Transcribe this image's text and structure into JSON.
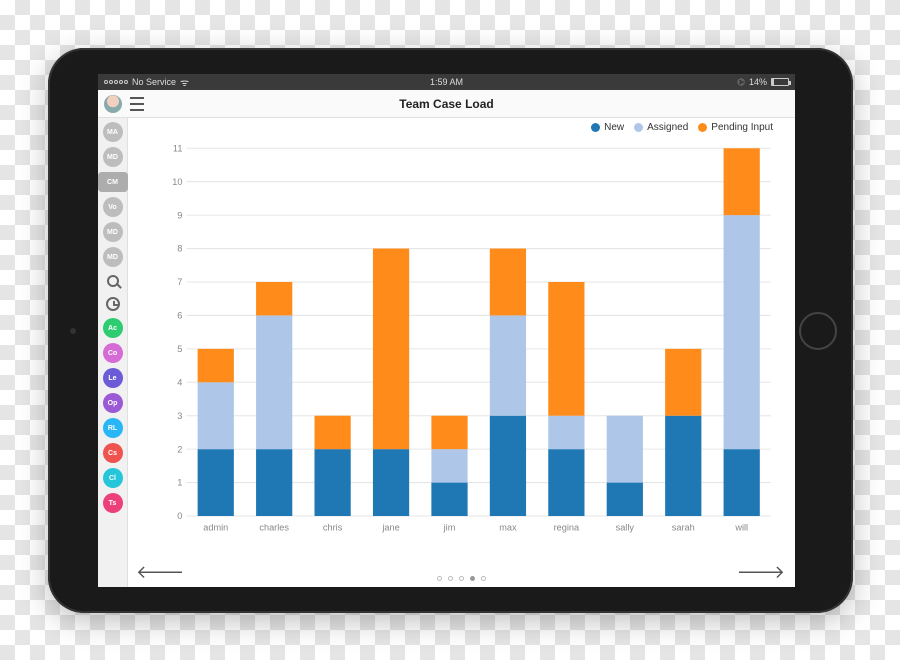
{
  "status": {
    "carrier": "No Service",
    "time": "1:59 AM",
    "battery_pct": "14%"
  },
  "toolbar": {
    "title": "Team Case Load"
  },
  "sidebar": {
    "items": [
      {
        "label": "MA",
        "cls": "gray"
      },
      {
        "label": "MD",
        "cls": "gray"
      },
      {
        "label": "CM",
        "cls": "sel"
      },
      {
        "label": "Vo",
        "cls": "gray"
      },
      {
        "label": "MD",
        "cls": "gray"
      },
      {
        "label": "MD",
        "cls": "gray"
      }
    ],
    "apps": [
      {
        "label": "Ac",
        "color": "#2ecc71"
      },
      {
        "label": "Co",
        "color": "#d66bd6"
      },
      {
        "label": "Le",
        "color": "#6b5bd6"
      },
      {
        "label": "Op",
        "color": "#9b59d6"
      },
      {
        "label": "RL",
        "color": "#29b6f6"
      },
      {
        "label": "Cs",
        "color": "#ef5350"
      },
      {
        "label": "Cl",
        "color": "#26c6da"
      },
      {
        "label": "Ts",
        "color": "#ec407a"
      }
    ]
  },
  "legend": {
    "items": [
      {
        "label": "New",
        "color": "#1f77b4"
      },
      {
        "label": "Assigned",
        "color": "#aec7e8"
      },
      {
        "label": "Pending Input",
        "color": "#ff8c1a"
      }
    ]
  },
  "pager": {
    "count": 5,
    "active_index": 3
  },
  "chart_data": {
    "type": "bar",
    "stacked": true,
    "title": "Team Case Load",
    "xlabel": "",
    "ylabel": "",
    "ylim": [
      0,
      11
    ],
    "yticks": [
      0,
      1,
      2,
      3,
      4,
      5,
      6,
      7,
      8,
      9,
      10,
      11
    ],
    "categories": [
      "admin",
      "charles",
      "chris",
      "jane",
      "jim",
      "max",
      "regina",
      "sally",
      "sarah",
      "will"
    ],
    "series": [
      {
        "name": "New",
        "color": "#1f77b4",
        "values": [
          2,
          2,
          2,
          2,
          1,
          3,
          2,
          1,
          3,
          2
        ]
      },
      {
        "name": "Assigned",
        "color": "#aec7e8",
        "values": [
          2,
          4,
          0,
          0,
          1,
          3,
          1,
          2,
          0,
          7
        ]
      },
      {
        "name": "Pending Input",
        "color": "#ff8c1a",
        "values": [
          1,
          1,
          1,
          6,
          1,
          2,
          4,
          0,
          2,
          2
        ]
      }
    ],
    "totals": [
      5,
      7,
      3,
      8,
      3,
      8,
      7,
      3,
      5,
      11
    ]
  }
}
